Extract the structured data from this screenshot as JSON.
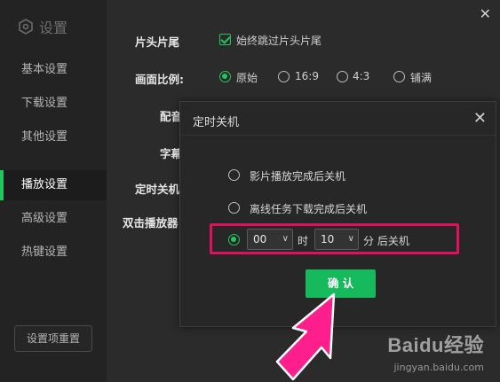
{
  "sidebar": {
    "title": "设置",
    "items": [
      {
        "label": "基本设置"
      },
      {
        "label": "下载设置"
      },
      {
        "label": "其他设置"
      },
      {
        "label": "播放设置",
        "active": true
      },
      {
        "label": "高级设置"
      },
      {
        "label": "热键设置"
      }
    ],
    "reset_button": "设置项重置"
  },
  "main": {
    "rows": {
      "intro": {
        "label": "片头片尾",
        "checkbox_label": "始终跳过片头片尾"
      },
      "aspect": {
        "label": "画面比例:",
        "options": [
          "原始",
          "16:9",
          "4:3",
          "铺满"
        ],
        "selected": "原始"
      },
      "audio": {
        "label": "配音"
      },
      "subtitle": {
        "label": "字幕"
      },
      "shutdown": {
        "label": "定时关机"
      },
      "double_click": {
        "label": "双击播放器"
      }
    }
  },
  "dialog": {
    "title": "定时关机",
    "options": [
      "影片播放完成后关机",
      "离线任务下载完成后关机"
    ],
    "timer": {
      "hours": "00",
      "hours_unit": "时",
      "minutes": "10",
      "minutes_unit": "分 后关机"
    },
    "confirm_button": "确 认"
  },
  "colors": {
    "accent": "#22c55e",
    "highlight": "#e0105a",
    "arrow": "#ff1f8c"
  },
  "watermark": {
    "logo": "Baidu经验",
    "url": "jingyan.baidu.com"
  }
}
